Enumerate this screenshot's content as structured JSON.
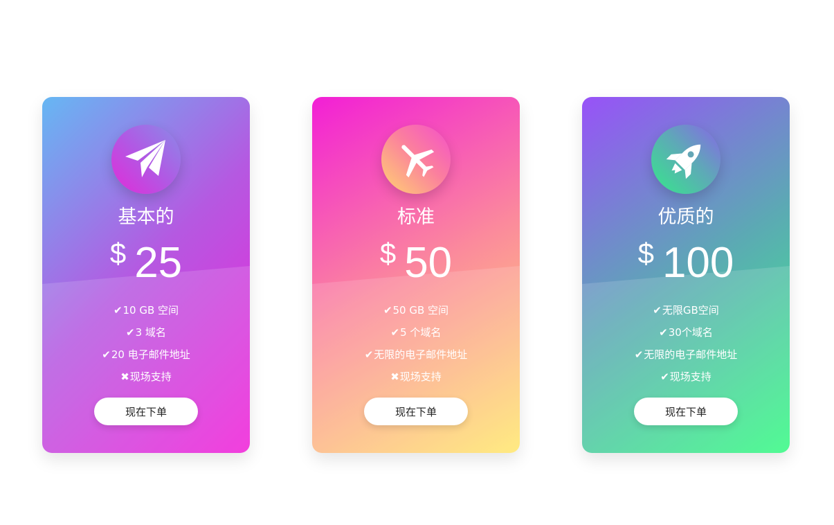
{
  "plans": [
    {
      "icon": "paper-plane-icon",
      "name": "基本的",
      "currency": "$",
      "price": "25",
      "features": [
        {
          "mark": "✔",
          "mark_icon": "check-icon",
          "text": "10 GB 空间"
        },
        {
          "mark": "✔",
          "mark_icon": "check-icon",
          "text": "3 域名"
        },
        {
          "mark": "✔",
          "mark_icon": "check-icon",
          "text": "20 电子邮件地址"
        },
        {
          "mark": "✖",
          "mark_icon": "cross-icon",
          "text": "现场支持"
        }
      ],
      "button_label": "现在下单"
    },
    {
      "icon": "airplane-icon",
      "name": "标准",
      "currency": "$",
      "price": "50",
      "features": [
        {
          "mark": "✔",
          "mark_icon": "check-icon",
          "text": "50 GB 空间"
        },
        {
          "mark": "✔",
          "mark_icon": "check-icon",
          "text": "5 个域名"
        },
        {
          "mark": "✔",
          "mark_icon": "check-icon",
          "text": "无限的电子邮件地址"
        },
        {
          "mark": "✖",
          "mark_icon": "cross-icon",
          "text": "现场支持"
        }
      ],
      "button_label": "现在下单"
    },
    {
      "icon": "rocket-icon",
      "name": "优质的",
      "currency": "$",
      "price": "100",
      "features": [
        {
          "mark": "✔",
          "mark_icon": "check-icon",
          "text": "无限GB空间"
        },
        {
          "mark": "✔",
          "mark_icon": "check-icon",
          "text": "30个域名"
        },
        {
          "mark": "✔",
          "mark_icon": "check-icon",
          "text": "无限的电子邮件地址"
        },
        {
          "mark": "✔",
          "mark_icon": "check-icon",
          "text": "现场支持"
        }
      ],
      "button_label": "现在下单"
    }
  ]
}
